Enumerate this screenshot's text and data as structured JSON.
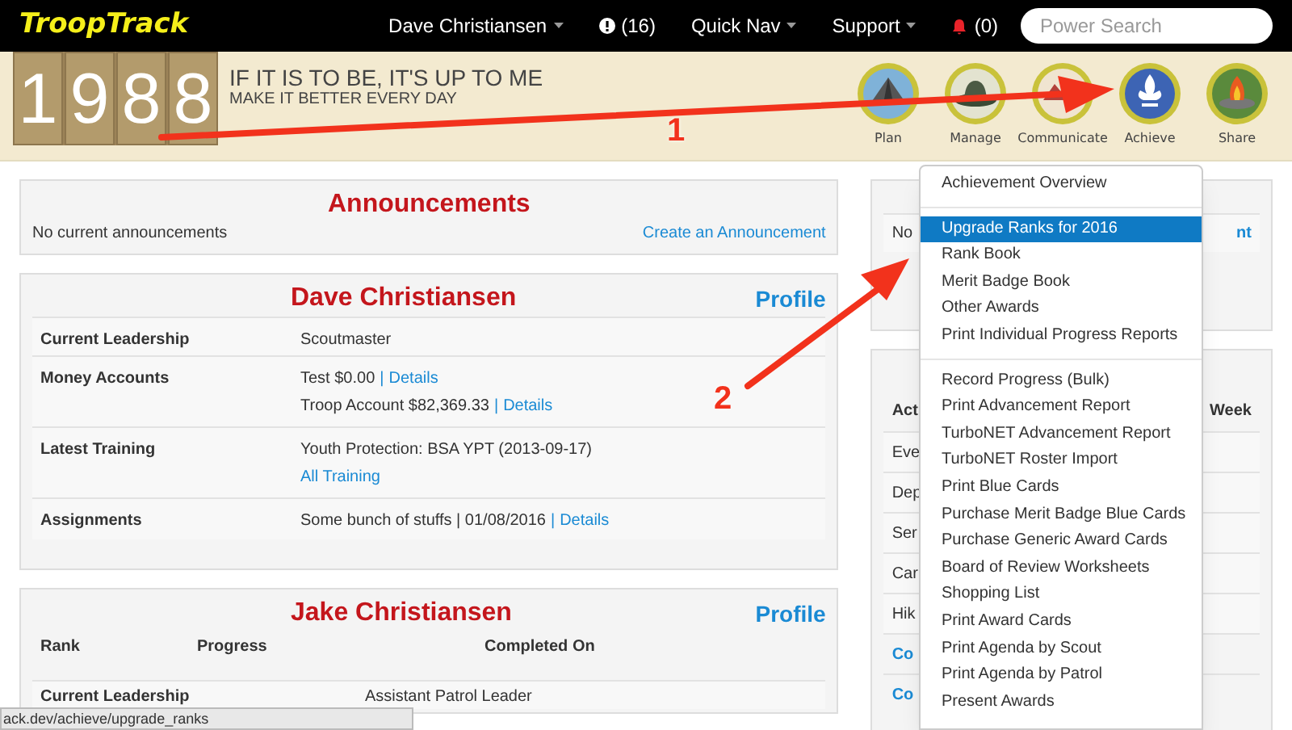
{
  "navbar": {
    "brand": "TroopTrack",
    "items": [
      {
        "label": "Dave Christiansen",
        "kind": "dropdown"
      },
      {
        "label": "(16)",
        "kind": "alert"
      },
      {
        "label": "Quick Nav",
        "kind": "dropdown"
      },
      {
        "label": "Support",
        "kind": "dropdown"
      },
      {
        "label": "(0)",
        "kind": "bell"
      }
    ],
    "search": {
      "placeholder": "Power Search"
    }
  },
  "banner": {
    "digits": [
      "1",
      "9",
      "8",
      "8"
    ],
    "motto": "IF IT IS TO BE, IT'S UP TO ME",
    "sub_motto": "MAKE IT BETTER EVERY DAY",
    "badges": [
      {
        "label": "Plan",
        "kind": "tent"
      },
      {
        "label": "Manage",
        "kind": "hat"
      },
      {
        "label": "Communicate",
        "kind": "mountains"
      },
      {
        "label": "Achieve",
        "kind": "fleur"
      },
      {
        "label": "Share",
        "kind": "fire"
      }
    ]
  },
  "announcements": {
    "title": "Announcements",
    "text": "No current announcements",
    "link": "Create an Announcement"
  },
  "leader_card": {
    "name": "Dave Christiansen",
    "profile_link": "Profile",
    "rows": [
      {
        "label": "Current Leadership",
        "lines": [
          {
            "text": "Scoutmaster"
          }
        ]
      },
      {
        "label": "Money Accounts",
        "lines": [
          {
            "text": "Test $0.00",
            "sep": "|",
            "link": "Details"
          },
          {
            "text": "Troop Account $82,369.33",
            "sep": "|",
            "link": "Details"
          }
        ]
      },
      {
        "label": "Latest Training",
        "lines": [
          {
            "text": "Youth Protection: BSA YPT (2013-09-17)"
          },
          {
            "link": "All Training"
          }
        ]
      },
      {
        "label": "Assignments",
        "lines": [
          {
            "text": "Some bunch of stuffs | 01/08/2016",
            "sep": "|",
            "link": "Details"
          }
        ]
      }
    ]
  },
  "scout_card": {
    "name": "Jake Christiansen",
    "profile_link": "Profile",
    "columns": [
      "Rank",
      "Progress",
      "Completed On"
    ],
    "row": {
      "label": "Current Leadership",
      "value": "Assistant Patrol Leader"
    }
  },
  "right_panel": {
    "top_text": "No",
    "top_link": "nt",
    "header_left": "Act",
    "header_right": "Week",
    "rows": [
      {
        "text": "Eve",
        "link": false
      },
      {
        "text": "Dep",
        "link": false
      },
      {
        "text": "Ser",
        "link": false
      },
      {
        "text": "Car",
        "link": false
      },
      {
        "text": "Hik",
        "link": false
      },
      {
        "text": "Co",
        "link": true
      },
      {
        "text": "Co",
        "link": true
      }
    ]
  },
  "menu": {
    "sections": [
      [
        {
          "label": "Achievement Overview",
          "selected": false
        }
      ],
      [
        {
          "label": "Upgrade Ranks for 2016",
          "selected": true
        },
        {
          "label": "Rank Book",
          "selected": false
        },
        {
          "label": "Merit Badge Book",
          "selected": false
        },
        {
          "label": "Other Awards",
          "selected": false
        },
        {
          "label": "Print Individual Progress Reports",
          "selected": false
        }
      ],
      [
        {
          "label": "Record Progress (Bulk)",
          "selected": false
        },
        {
          "label": "Print Advancement Report",
          "selected": false
        },
        {
          "label": "TurboNET Advancement Report",
          "selected": false
        },
        {
          "label": "TurboNET Roster Import",
          "selected": false
        },
        {
          "label": "Print Blue Cards",
          "selected": false
        },
        {
          "label": "Purchase Merit Badge Blue Cards",
          "selected": false
        },
        {
          "label": "Purchase Generic Award Cards",
          "selected": false
        },
        {
          "label": "Board of Review Worksheets",
          "selected": false
        },
        {
          "label": "Shopping List",
          "selected": false
        },
        {
          "label": "Print Award Cards",
          "selected": false
        },
        {
          "label": "Print Agenda by Scout",
          "selected": false
        },
        {
          "label": "Print Agenda by Patrol",
          "selected": false
        },
        {
          "label": "Present Awards",
          "selected": false
        }
      ]
    ]
  },
  "annotations": [
    "1",
    "2"
  ],
  "status_bar": "ack.dev/achieve/upgrade_ranks"
}
